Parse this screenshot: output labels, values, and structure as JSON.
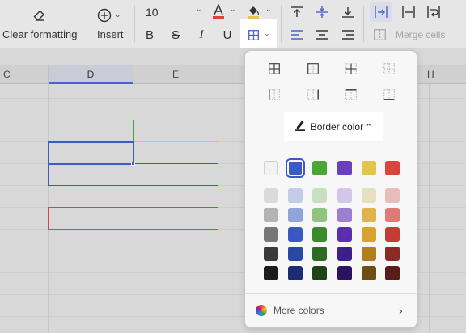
{
  "toolbar": {
    "clear_formatting": "Clear formatting",
    "insert": "Insert",
    "font_size": "10",
    "merge_cells": "Merge cells"
  },
  "columns": [
    "C",
    "D",
    "E",
    "H"
  ],
  "popover": {
    "border_color_label": "Border color",
    "more_colors_label": "More colors",
    "swatches": [
      [
        "#f2f2f2",
        "#3c5ac6",
        "#4aa636",
        "#6a3fbf",
        "#e2c54b",
        "#d9453b"
      ],
      [
        "#dadada",
        "#c3cbe6",
        "#c8dfc1",
        "#d3c6e6",
        "#e8dfc1",
        "#e8bcbb"
      ],
      [
        "#b3b3b3",
        "#93a4d9",
        "#90c481",
        "#9c7fd1",
        "#e3b24c",
        "#e07a74"
      ],
      [
        "#777777",
        "#3b57c4",
        "#3c8a2c",
        "#5a2fae",
        "#d7a22e",
        "#c23d34"
      ],
      [
        "#3a3a3a",
        "#2848a6",
        "#2d6a22",
        "#3c1f88",
        "#b07f1f",
        "#8c2a25"
      ],
      [
        "#1c1c1c",
        "#1a2d73",
        "#1e4318",
        "#2a1462",
        "#6e4f12",
        "#5b1b18"
      ]
    ],
    "selected_swatch": "#3c5ac6"
  },
  "colors": {
    "accent": "#4a63c9",
    "green_border": "#4aa636",
    "yellow_border": "#e2c54b",
    "blue_border": "#3c5ac6",
    "red_border": "#d9453b"
  }
}
